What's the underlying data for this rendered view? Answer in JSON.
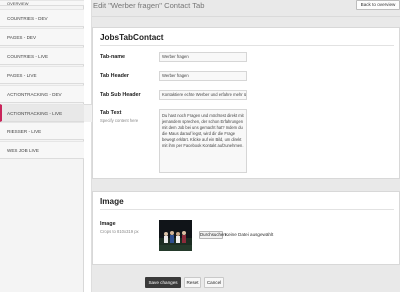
{
  "sidebar": {
    "items": [
      {
        "label": "OVERVIEW"
      },
      {
        "label": "COUNTRIES - DEV"
      },
      {
        "label": "PAGES - DEV"
      },
      {
        "label": "COUNTRIES - LIVE"
      },
      {
        "label": "PAGES - LIVE"
      },
      {
        "label": "ACTIONTRACKING - DEV"
      },
      {
        "label": "ACTIONTRACKING - LIVE",
        "active": true
      },
      {
        "label": "RIESSER - LIVE"
      },
      {
        "label": "WES JOB LIVE"
      }
    ]
  },
  "header": {
    "title": "Edit \"Werber fragen\" Contact Tab",
    "back_label": "Back to overview"
  },
  "section1": {
    "title": "JobsTabContact",
    "fields": [
      {
        "label": "Tab-name",
        "value": "Werber fragen"
      },
      {
        "label": "Tab Header",
        "value": "Werber fragen"
      },
      {
        "label": "Tab Sub Header",
        "value": "Kontaktiere echte Werber und erfahre mehr über..."
      }
    ],
    "text": {
      "label": "Tab Text",
      "hint": "Specify content here",
      "value": "Du hast noch Fragen und möchtest direkt mit jemandem sprechen, der schon Erfahrungen mit dem Job bei uns gemacht hat? Indem du die Maus darauf legst, wird dir die Frage bewegt erklärt. Klicke auf ein Bild, um direkt mit ihm per Facebook Kontakt aufzunehmen."
    }
  },
  "section2": {
    "title": "Image",
    "label": "Image",
    "hint": "Crops to 810x319 px",
    "file_button": "Durchsuchen...",
    "file_status": "Keine Datei ausgewählt"
  },
  "actions": {
    "save": "Save changes",
    "reset": "Reset",
    "cancel": "Cancel"
  },
  "colors": {
    "accent": "#c9245a",
    "primary_button": "#3a3a3a"
  }
}
